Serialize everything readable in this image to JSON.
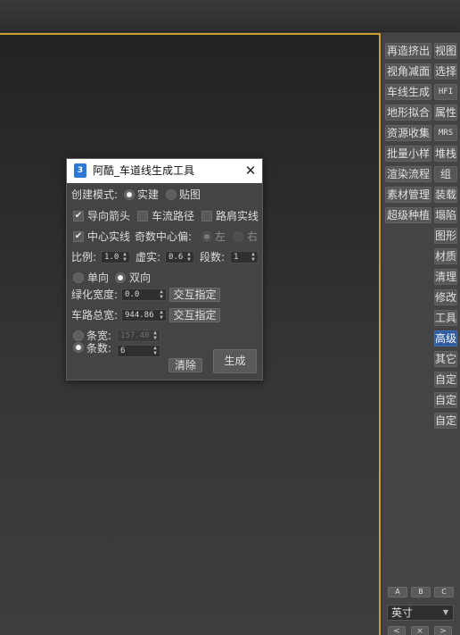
{
  "dialog": {
    "title": "阿酷_车道线生成工具",
    "icon_text": "3",
    "create_mode_label": "创建模式:",
    "mode_options": [
      {
        "label": "实建",
        "selected": true
      },
      {
        "label": "贴图",
        "selected": false
      }
    ],
    "checks": [
      {
        "label": "导向箭头",
        "checked": true
      },
      {
        "label": "车流路径",
        "checked": false
      },
      {
        "label": "路肩实线",
        "checked": false
      },
      {
        "label": "中心实线",
        "checked": true
      }
    ],
    "odd_center_label": "奇数中心偏:",
    "odd_options": [
      {
        "label": "左",
        "selected": true
      },
      {
        "label": "右",
        "selected": false
      }
    ],
    "scale_label": "比例:",
    "scale_value": "1.0",
    "dash_label": "虚实:",
    "dash_value": "0.6",
    "segments_label": "段数:",
    "segments_value": "1",
    "direction_options": [
      {
        "label": "单向",
        "selected": false
      },
      {
        "label": "双向",
        "selected": true
      }
    ],
    "green_width_label": "绿化宽度:",
    "green_width_value": "0.0",
    "green_pick_button": "交互指定",
    "road_width_label": "车路总宽:",
    "road_width_value": "944.86",
    "road_pick_button": "交互指定",
    "lane_width_label": "条宽:",
    "lane_width_value": "157.48",
    "lane_count_label": "条数:",
    "lane_count_value": "6",
    "clear_button": "清除",
    "generate_button": "生成"
  },
  "panel": {
    "pairs": [
      [
        "再造挤出",
        "视图"
      ],
      [
        "视角减面",
        "选择"
      ],
      [
        "车线生成",
        "HFI"
      ],
      [
        "地形拟合",
        "属性"
      ],
      [
        "资源收集",
        "MRS"
      ],
      [
        "批量小样",
        "堆栈"
      ],
      [
        "渲染流程",
        "组"
      ],
      [
        "素材管理",
        "装载"
      ],
      [
        "超级种植",
        "塌陷"
      ]
    ],
    "singles": [
      "图形",
      "材质",
      "清理",
      "修改",
      "工具",
      "高级",
      "其它",
      "自定",
      "自定",
      "自定"
    ],
    "active_single": "高级",
    "abc": [
      "A",
      "B",
      "C"
    ],
    "unit": "英寸",
    "nav": [
      "<",
      "×",
      ">"
    ]
  },
  "colors": {
    "viewport_border": "#c9a030",
    "active_button": "#2e5a9e"
  }
}
